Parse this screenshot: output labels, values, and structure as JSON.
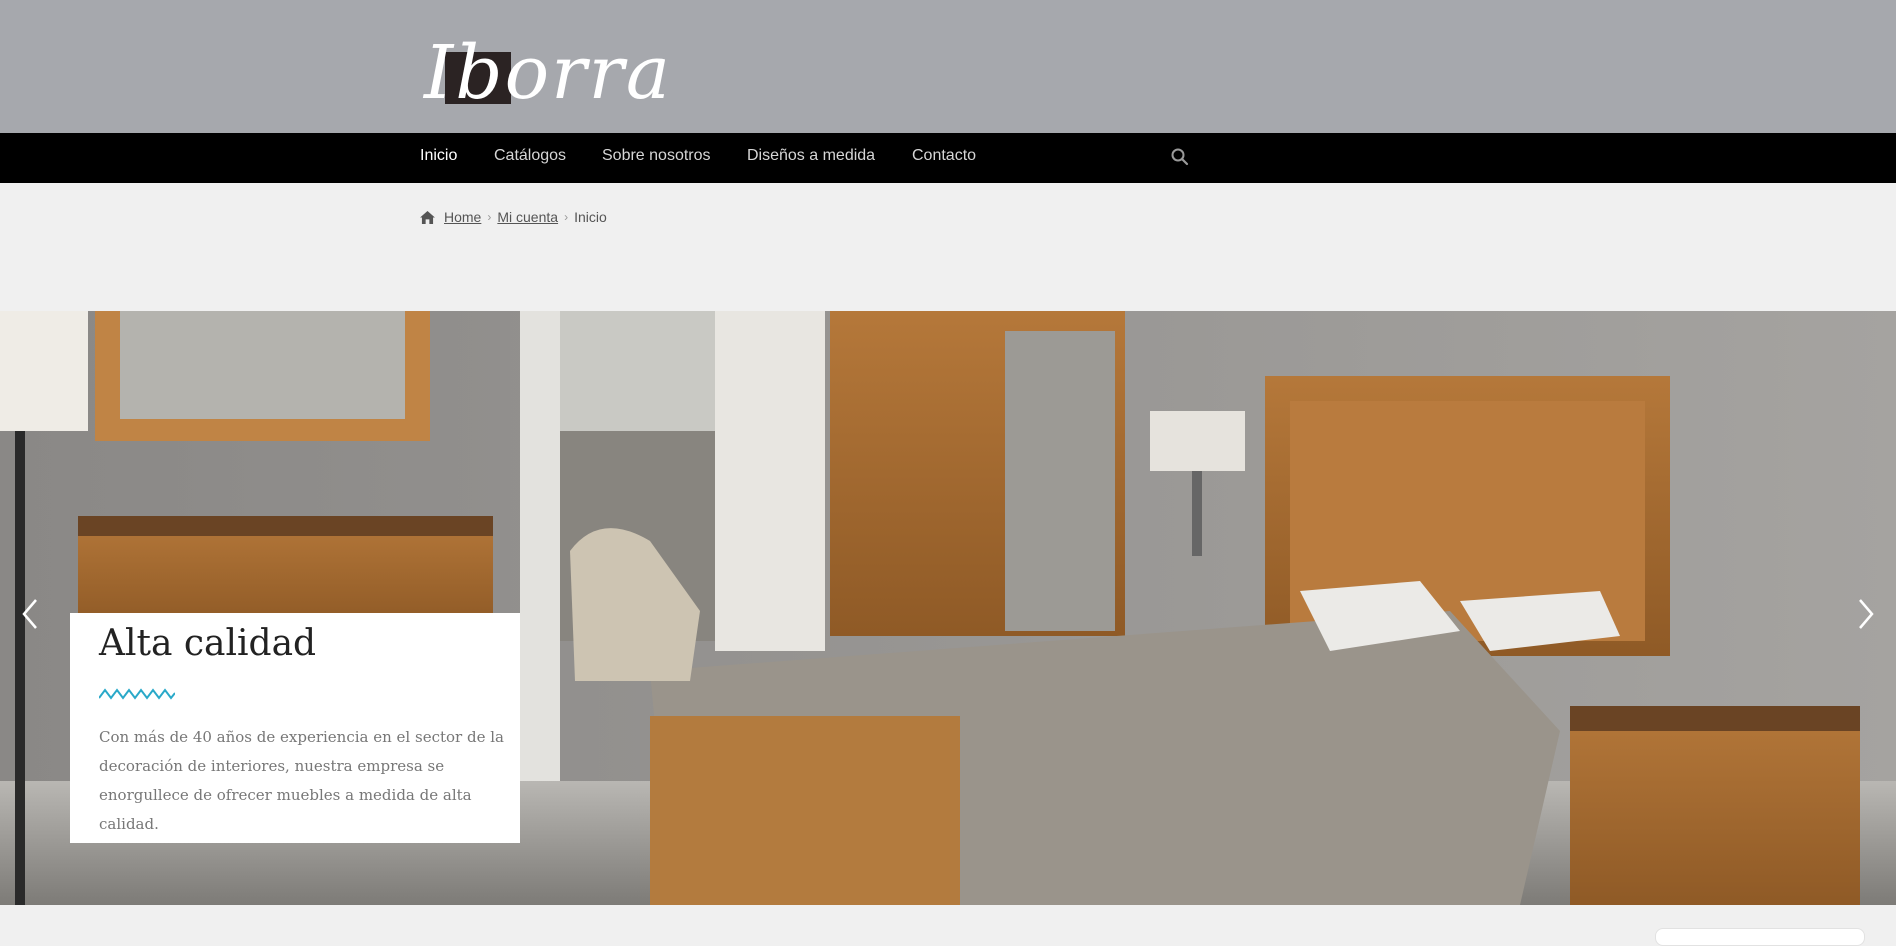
{
  "header": {
    "logo_text": "Iborra"
  },
  "nav": {
    "items": [
      {
        "label": "Inicio",
        "active": true
      },
      {
        "label": "Catálogos"
      },
      {
        "label": "Sobre nosotros"
      },
      {
        "label": "Diseños a medida"
      },
      {
        "label": "Contacto"
      }
    ],
    "search_icon": "search-icon"
  },
  "breadcrumb": {
    "icon": "home-icon",
    "items": [
      "Home",
      "Mi cuenta",
      "Inicio"
    ]
  },
  "slider": {
    "prev_icon": "chevron-left-icon",
    "next_icon": "chevron-right-icon",
    "slide": {
      "title": "Alta calidad",
      "text": "Con más de 40 años de experiencia en el sector de la decoración de interiores, nuestra empresa se enorgullece de ofrecer muebles a medida de alta calidad.",
      "wave_color": "#2aa9c9"
    }
  },
  "colors": {
    "header_bg": "#a6a8ad",
    "nav_bg": "#000000",
    "page_bg": "#f0f0f0"
  }
}
